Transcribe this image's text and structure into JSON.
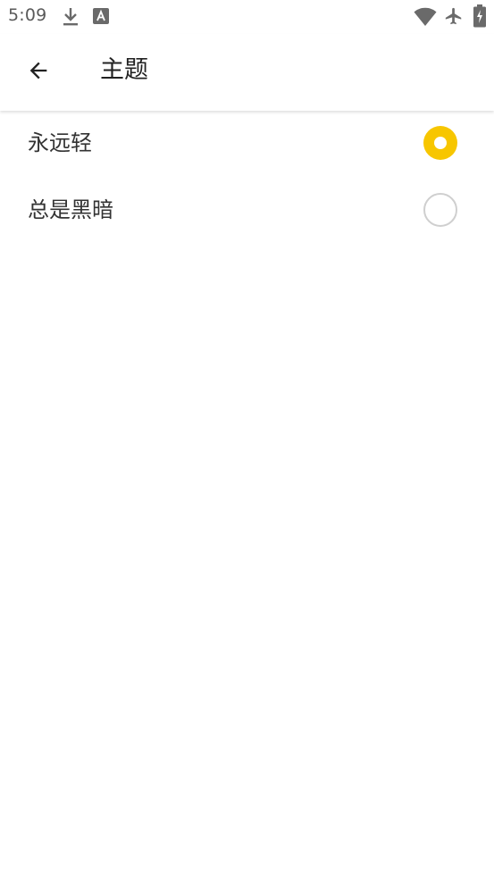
{
  "status_bar": {
    "time": "5:09",
    "icons": [
      "download-icon",
      "font-icon",
      "wifi-icon",
      "airplane-mode-icon",
      "battery-charging-icon"
    ]
  },
  "app_bar": {
    "back_icon": "arrow-left-icon",
    "title": "主题"
  },
  "theme_options": [
    {
      "label": "永远轻",
      "selected": true
    },
    {
      "label": "总是黑暗",
      "selected": false
    }
  ],
  "colors": {
    "accent": "#f7c600",
    "radio_unchecked_border": "#cfcfcf",
    "text_primary": "#212121"
  }
}
